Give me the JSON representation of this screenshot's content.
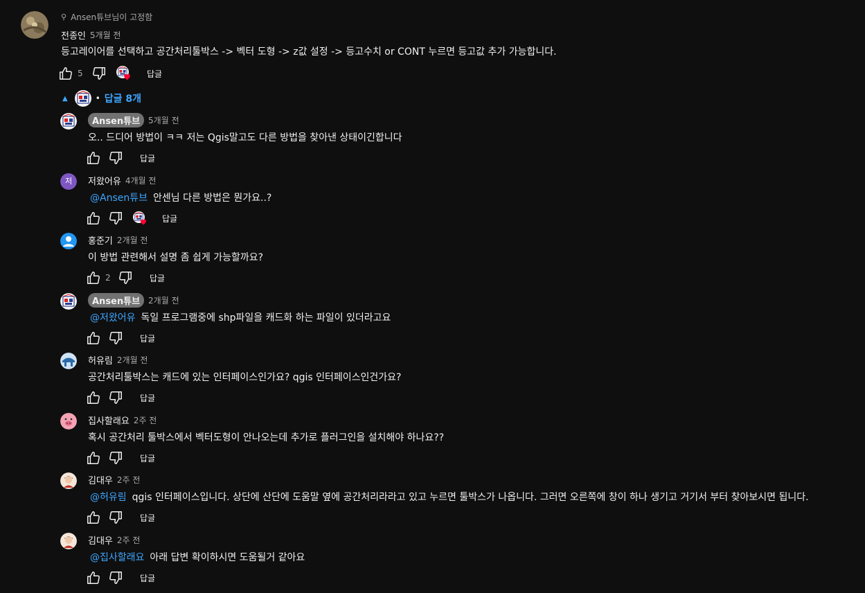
{
  "colors": {
    "background": "#0f0f0f",
    "text": "#f1f1f1",
    "muted": "#aaaaaa",
    "link": "#3ea6ff",
    "heart": "#ff0033"
  },
  "top": {
    "pinned_label": "Ansen튜브님이 고정함",
    "author": "전종인",
    "time": "5개월 전",
    "text": "등고레이어를 선택하고 공간처리툴박스 -> 벡터 도형 -> z값 설정 -> 등고수치 or CONT 누르면 등고값 추가 가능합니다.",
    "likes": "5",
    "reply_label": "답글"
  },
  "replies_toggle": {
    "label": "답글 8개",
    "separator": "•"
  },
  "replies": [
    {
      "author": "Ansen튜브",
      "pill": true,
      "time": "5개월 전",
      "mention": "",
      "text": "오.. 드디어 방법이 ㅋㅋ 저는 Qgis말고도 다른 방법을 찾아낸 상태이긴합니다",
      "likes": "",
      "heart": false,
      "reply_label": "답글",
      "avatar": "ansen"
    },
    {
      "author": "저왔어유",
      "pill": false,
      "time": "4개월 전",
      "mention": "@Ansen튜브",
      "text": "안센님 다른 방법은 뭔가요..?",
      "likes": "",
      "heart": true,
      "reply_label": "답글",
      "avatar": "letter",
      "avatar_letter": "저"
    },
    {
      "author": "홍준기",
      "pill": false,
      "time": "2개월 전",
      "mention": "",
      "text": "이 방법 관련해서 설명 좀 쉽게 가능할까요?",
      "likes": "2",
      "heart": false,
      "reply_label": "답글",
      "avatar": "person"
    },
    {
      "author": "Ansen튜브",
      "pill": true,
      "time": "2개월 전",
      "mention": "@저왔어유",
      "text": "독일 프로그램중에 shp파일을 캐드화 하는 파일이 있더라고요",
      "likes": "",
      "heart": false,
      "reply_label": "답글",
      "avatar": "ansen"
    },
    {
      "author": "허유림",
      "pill": false,
      "time": "2개월 전",
      "mention": "",
      "text": "공간처리툴박스는 캐드에 있는 인터페이스인가요? qgis 인터페이스인건가요?",
      "likes": "",
      "heart": false,
      "reply_label": "답글",
      "avatar": "arch"
    },
    {
      "author": "집사할래요",
      "pill": false,
      "time": "2주 전",
      "mention": "",
      "text": "혹시 공간처리 툴박스에서 벡터도형이 안나오는데 추가로 플러그인을 설치해야 하나요??",
      "likes": "",
      "heart": false,
      "reply_label": "답글",
      "avatar": "pig"
    },
    {
      "author": "김대우",
      "pill": false,
      "time": "2주 전",
      "mention": "@허유림",
      "text": "qgis 인터페이스입니다. 상단에 산단에 도움말 옆에 공간처리라라고 있고 누르면 툴박스가 나옵니다. 그러면 오른쪽에 창이 하나 생기고 거기서 부터 찾아보시면 됩니다.",
      "likes": "",
      "heart": false,
      "reply_label": "답글",
      "avatar": "face"
    },
    {
      "author": "김대우",
      "pill": false,
      "time": "2주 전",
      "mention": "@집사할래요",
      "text": "아래 답변 확이하시면 도움될거 같아요",
      "likes": "",
      "heart": false,
      "reply_label": "답글",
      "avatar": "face"
    }
  ]
}
